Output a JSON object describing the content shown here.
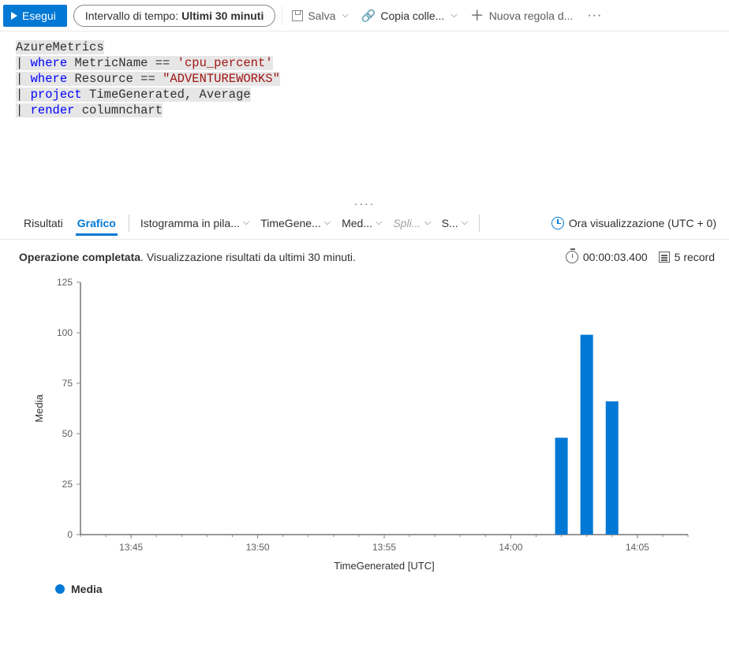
{
  "toolbar": {
    "run_label": "Esegui",
    "time_prefix": "Intervallo di tempo:",
    "time_value": "Ultimi 30 minuti",
    "save_label": "Salva",
    "copy_label": "Copia colle...",
    "new_rule_label": "Nuova regola d..."
  },
  "query": {
    "line1": "AzureMetrics",
    "line2_where": "where",
    "line2_rest": "MetricName == ",
    "line2_str": "'cpu_percent'",
    "line3_where": "where",
    "line3_rest": "Resource == ",
    "line3_str": "\"ADVENTUREWORKS\"",
    "line4_project": "project",
    "line4_rest": " TimeGenerated, Average",
    "line5_render": "render",
    "line5_rest": " columnchart"
  },
  "result_tabs": {
    "results": "Risultati",
    "chart": "Grafico",
    "dd_histogram": "Istogramma in pila...",
    "dd_timegen": "TimeGene...",
    "dd_med": "Med...",
    "dd_split": "Spli...",
    "dd_s": "S...",
    "time_display": "Ora visualizzazione (UTC + 0)"
  },
  "status": {
    "completed": "Operazione completata",
    "subtitle": ". Visualizzazione risultati da ultimi 30 minuti.",
    "duration": "00:00:03.400",
    "records": "5 record"
  },
  "chart_data": {
    "type": "bar",
    "xlabel": "TimeGenerated [UTC]",
    "ylabel": "Media",
    "ylim": [
      0,
      125
    ],
    "y_ticks": [
      0,
      25,
      50,
      75,
      100,
      125
    ],
    "x_ticks": [
      "13:45",
      "13:50",
      "13:55",
      "14:00",
      "14:05"
    ],
    "series": [
      {
        "name": "Media",
        "values": [
          {
            "x": "14:02",
            "y": 48
          },
          {
            "x": "14:03",
            "y": 99
          },
          {
            "x": "14:04",
            "y": 66
          }
        ]
      }
    ]
  },
  "legend": {
    "label": "Media"
  }
}
